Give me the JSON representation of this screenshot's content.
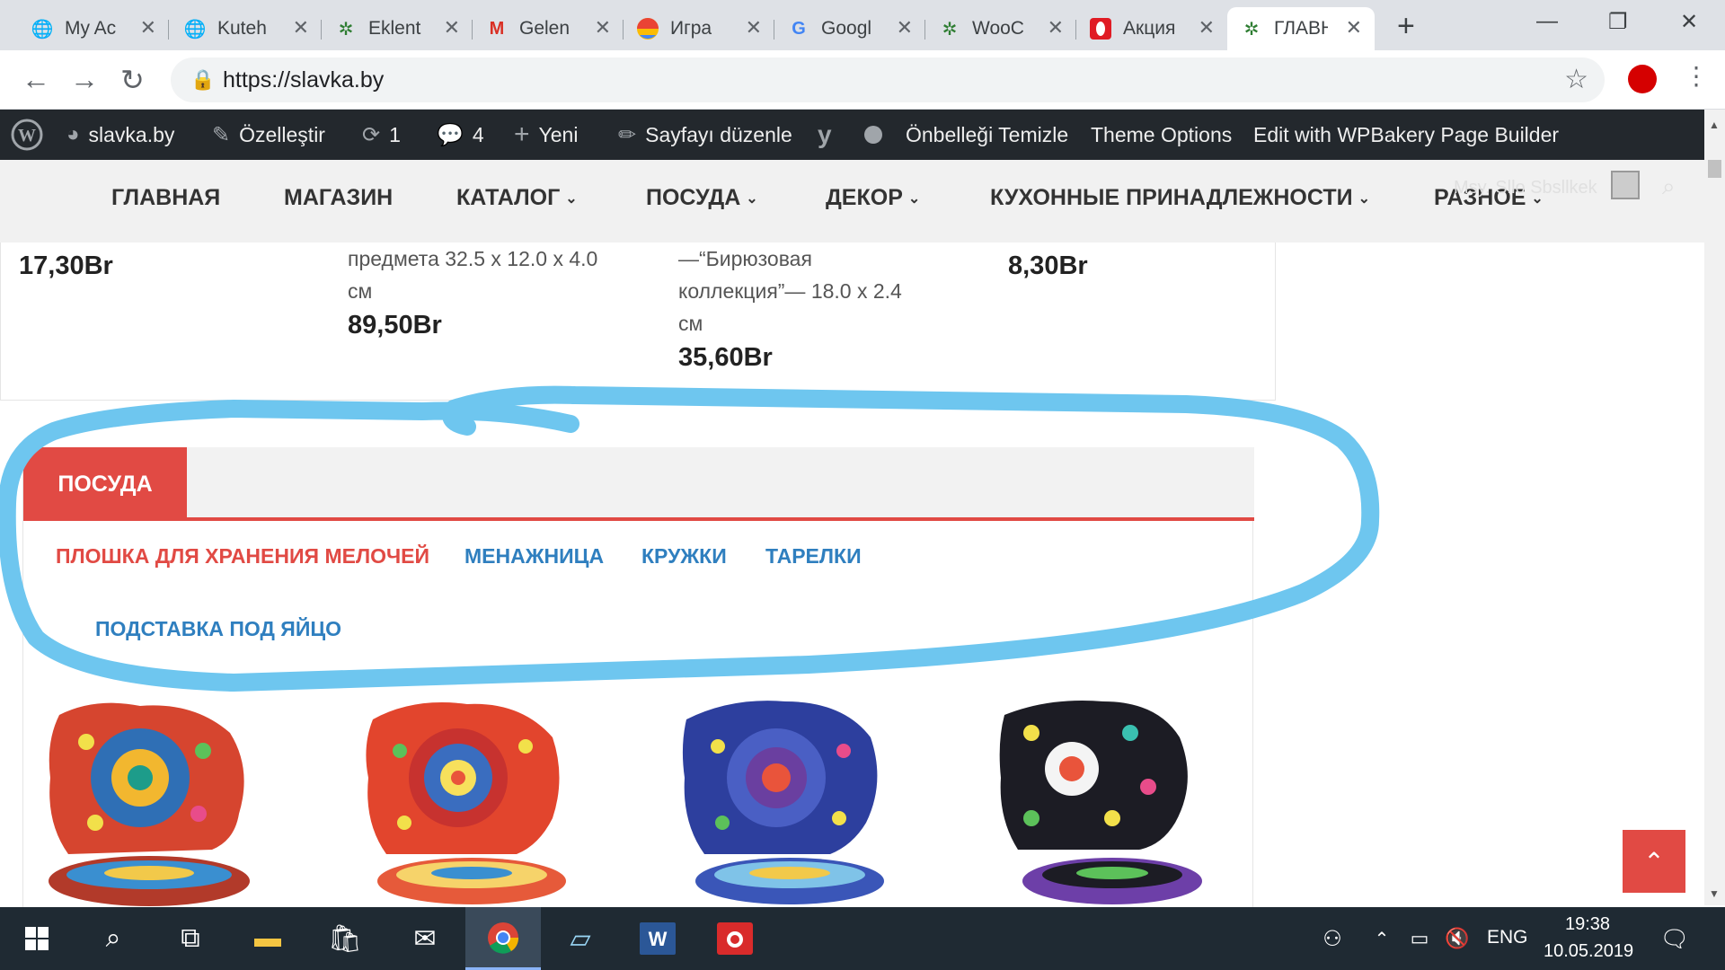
{
  "browser": {
    "tabs": [
      {
        "title": "My Ac",
        "icon": "globe-icon"
      },
      {
        "title": "Kuteh",
        "icon": "globe-icon"
      },
      {
        "title": "Eklent",
        "icon": "puzzle-icon"
      },
      {
        "title": "Gelen",
        "icon": "gmail-icon"
      },
      {
        "title": "Игра",
        "icon": "ball-icon"
      },
      {
        "title": "Googl",
        "icon": "translate-icon"
      },
      {
        "title": "WooC",
        "icon": "puzzle-icon"
      },
      {
        "title": "Акция",
        "icon": "opera-icon"
      },
      {
        "title": "ГЛАВН",
        "icon": "puzzle-icon"
      }
    ],
    "url": "https://slavka.by"
  },
  "adminbar": {
    "site": "slavka.by",
    "customize": "Özelleştir",
    "updates": "1",
    "comments": "4",
    "new": "Yeni",
    "edit_page": "Sayfayı düzenle",
    "clear_cache": "Önbelleği Temizle",
    "theme_options": "Theme Options",
    "wpbakery": "Edit with WPBakery Page Builder"
  },
  "sitenav": {
    "items": [
      "ГЛАВНАЯ",
      "МАГАЗИН",
      "КАТАЛОГ",
      "ПОСУДА",
      "ДЕКОР",
      "КУХОННЫЕ ПРИНАДЛЕЖНОСТИ",
      "РАЗНОЕ"
    ],
    "user": "Msy. Sllo Sbsllkek"
  },
  "products_top": {
    "p1_price": "17,30Br",
    "p2_desc": "предмета 32.5 x 12.0 x 4.0 см",
    "p2_price": "89,50Br",
    "p3_desc": "—“Бирюзовая коллекция”— 18.0 x 2.4 см",
    "p3_price": "35,60Br",
    "p4_price": "8,30Br"
  },
  "tabs_section": {
    "active_tab": "ПОСУДА",
    "categories": [
      "ПЛОШКА ДЛЯ ХРАНЕНИЯ МЕЛОЧЕЙ",
      "МЕНАЖНИЦА",
      "КРУЖКИ",
      "ТАРЕЛКИ",
      "ПОДСТАВКА ПОД ЯЙЦО"
    ]
  },
  "colors": {
    "accent": "#e14a44",
    "link": "#2f7fbf",
    "annotation": "#6ec6ef"
  },
  "taskbar": {
    "lang": "ENG",
    "time": "19:38",
    "date": "10.05.2019"
  }
}
